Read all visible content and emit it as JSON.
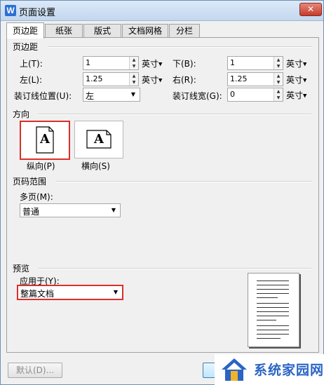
{
  "window": {
    "title": "页面设置",
    "app_icon_letter": "W",
    "close_glyph": "✕"
  },
  "tabs": [
    {
      "label": "页边距"
    },
    {
      "label": "纸张"
    },
    {
      "label": "版式"
    },
    {
      "label": "文档网格"
    },
    {
      "label": "分栏"
    }
  ],
  "margins": {
    "group_title": "页边距",
    "top": {
      "label": "上(T):",
      "value": "1",
      "unit": "英寸"
    },
    "bottom": {
      "label": "下(B):",
      "value": "1",
      "unit": "英寸"
    },
    "left": {
      "label": "左(L):",
      "value": "1.25",
      "unit": "英寸"
    },
    "right": {
      "label": "右(R):",
      "value": "1.25",
      "unit": "英寸"
    },
    "gutter_pos": {
      "label": "装订线位置(U):",
      "value": "左"
    },
    "gutter_width": {
      "label": "装订线宽(G):",
      "value": "0",
      "unit": "英寸"
    }
  },
  "orientation": {
    "group_title": "方向",
    "glyph": "A",
    "portrait": "纵向(P)",
    "landscape": "横向(S)"
  },
  "pages": {
    "group_title": "页码范围",
    "multi_label": "多页(M):",
    "multi_value": "普通"
  },
  "preview": {
    "group_title": "预览",
    "apply_label": "应用于(Y):",
    "apply_value": "整篇文档"
  },
  "footer": {
    "default_button": "默认(D)..."
  },
  "watermark": {
    "text": "系统家园网"
  }
}
